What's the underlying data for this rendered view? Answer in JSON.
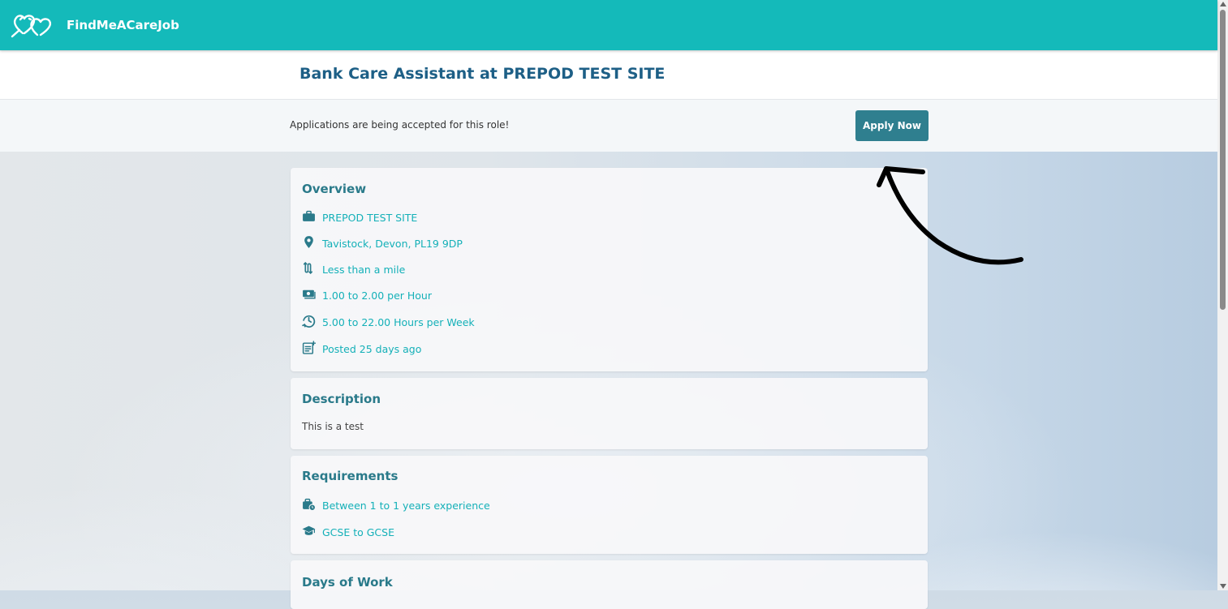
{
  "brand": {
    "name": "FindMeACareJob"
  },
  "job": {
    "title": "Bank Care Assistant at PREPOD TEST SITE"
  },
  "apply": {
    "message": "Applications are being accepted for this role!",
    "button_label": "Apply Now"
  },
  "overview": {
    "heading": "Overview",
    "items": [
      {
        "icon": "briefcase-icon",
        "text": "PREPOD TEST SITE"
      },
      {
        "icon": "map-pin-icon",
        "text": "Tavistock, Devon, PL19 9DP"
      },
      {
        "icon": "route-icon",
        "text": "Less than a mile"
      },
      {
        "icon": "cash-icon",
        "text": "1.00 to 2.00 per Hour"
      },
      {
        "icon": "clock-history-icon",
        "text": "5.00 to 22.00 Hours per Week"
      },
      {
        "icon": "posted-icon",
        "text": "Posted 25 days ago"
      }
    ]
  },
  "description": {
    "heading": "Description",
    "text": "This is a test"
  },
  "requirements": {
    "heading": "Requirements",
    "items": [
      {
        "icon": "briefcase-clock-icon",
        "text": "Between 1 to 1 years experience"
      },
      {
        "icon": "graduation-cap-icon",
        "text": "GCSE to GCSE"
      }
    ]
  },
  "days_of_work": {
    "heading": "Days of Work"
  },
  "colors": {
    "topbar": "#14baba",
    "title": "#1d5f86",
    "accent": "#14b0b8",
    "button": "#2f7f8f"
  }
}
